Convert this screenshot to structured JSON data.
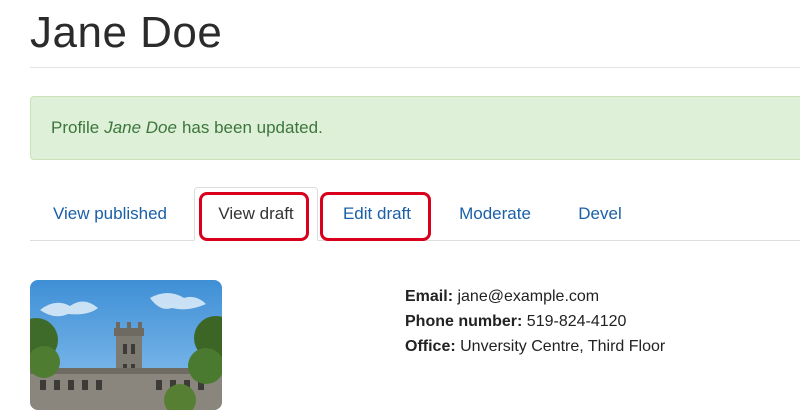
{
  "profile": {
    "name": "Jane Doe"
  },
  "message": {
    "prefix": "Profile",
    "name": "Jane Doe",
    "suffix": "has been updated."
  },
  "tabs": [
    {
      "label": "View published",
      "active": false,
      "highlighted": false
    },
    {
      "label": "View draft",
      "active": true,
      "highlighted": true
    },
    {
      "label": "Edit draft",
      "active": false,
      "highlighted": true
    },
    {
      "label": "Moderate",
      "active": false,
      "highlighted": false
    },
    {
      "label": "Devel",
      "active": false,
      "highlighted": false
    }
  ],
  "contact": {
    "email_label": "Email:",
    "email": "jane@example.com",
    "phone_label": "Phone number:",
    "phone": "519-824-4120",
    "office_label": "Office:",
    "office": "Unversity Centre, Third Floor"
  },
  "colors": {
    "link": "#1a5fa8",
    "success_bg": "#dff0d8",
    "success_text": "#3c763d",
    "highlight": "#d9001b"
  }
}
